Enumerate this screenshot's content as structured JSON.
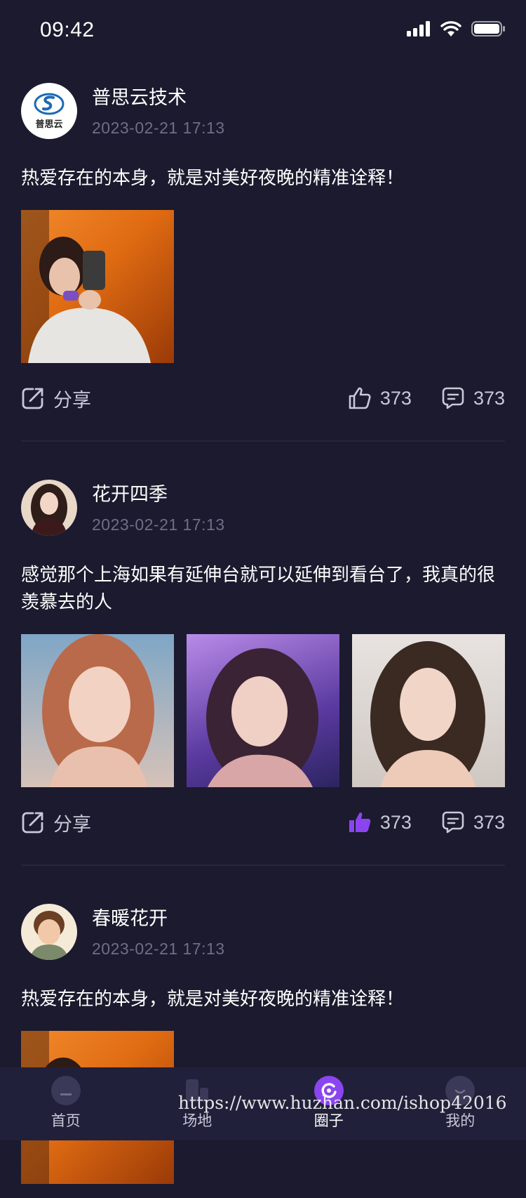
{
  "status_bar": {
    "time": "09:42"
  },
  "posts": [
    {
      "author": "普思云技术",
      "time": "2023-02-21 17:13",
      "text": "热爱存在的本身，就是对美好夜晚的精准诠释！",
      "share_label": "分享",
      "likes": "373",
      "comments": "373",
      "liked": false
    },
    {
      "author": "花开四季",
      "time": "2023-02-21 17:13",
      "text": "感觉那个上海如果有延伸台就可以延伸到看台了，我真的很羡慕去的人",
      "share_label": "分享",
      "likes": "373",
      "comments": "373",
      "liked": true
    },
    {
      "author": "春暖花开",
      "time": "2023-02-21 17:13",
      "text": "热爱存在的本身，就是对美好夜晚的精准诠释！"
    }
  ],
  "logo_text": "普思云",
  "tabbar": [
    {
      "label": "首页",
      "icon": "home-icon"
    },
    {
      "label": "场地",
      "icon": "venue-icon"
    },
    {
      "label": "圈子",
      "icon": "circle-icon",
      "active": true
    },
    {
      "label": "我的",
      "icon": "profile-icon"
    }
  ],
  "watermark": "https://www.huzhan.com/ishop42016",
  "colors": {
    "background": "#1b1a2e",
    "accent": "#8b45f0",
    "muted_text": "#6f6e86"
  }
}
